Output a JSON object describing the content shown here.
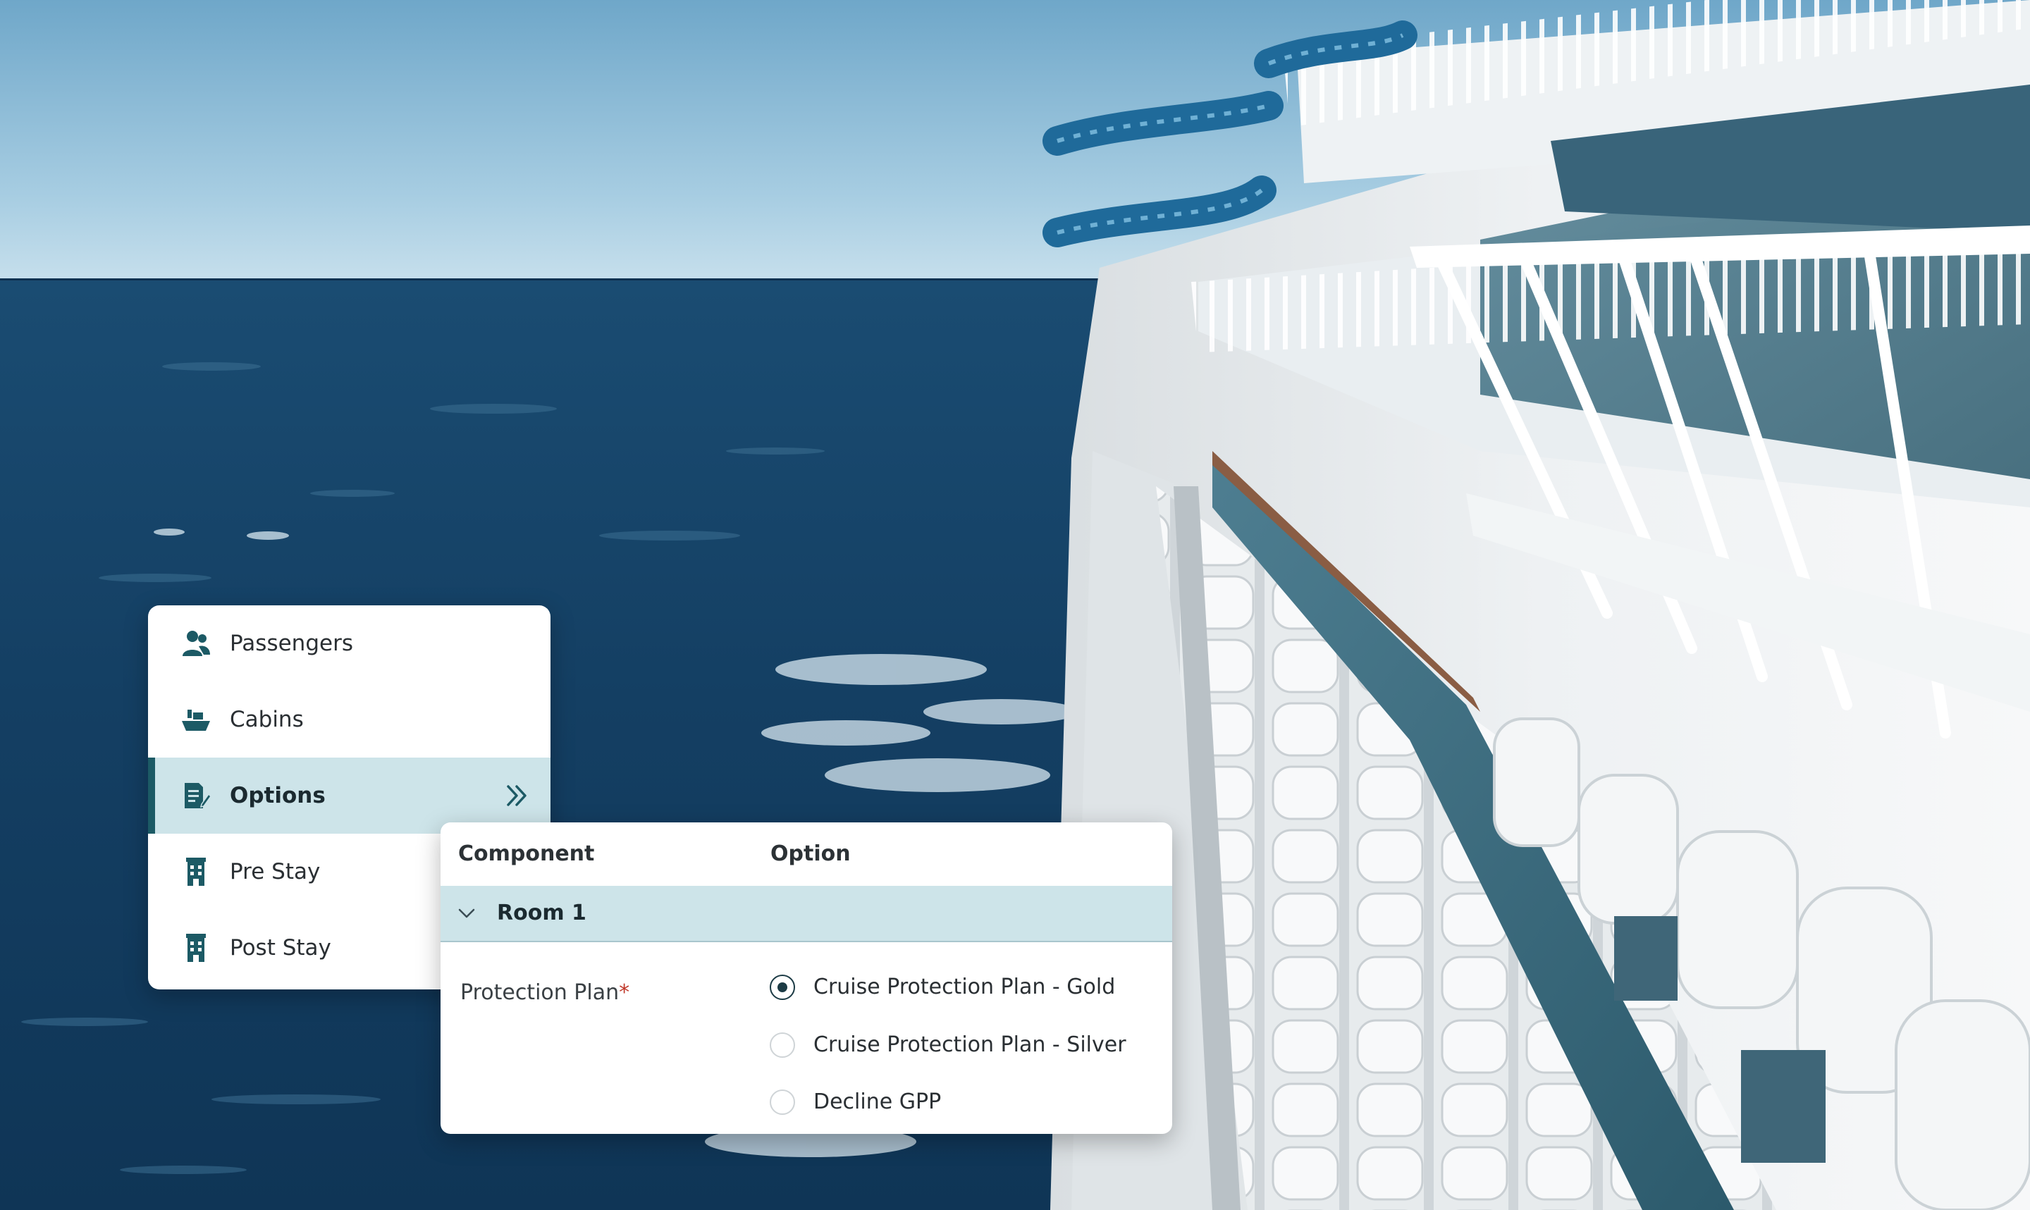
{
  "nav": {
    "items": [
      {
        "label": "Passengers",
        "icon": "passengers-icon",
        "active": false
      },
      {
        "label": "Cabins",
        "icon": "ship-icon",
        "active": false
      },
      {
        "label": "Options",
        "icon": "options-list-icon",
        "active": true
      },
      {
        "label": "Pre Stay",
        "icon": "hotel-icon",
        "active": false
      },
      {
        "label": "Post Stay",
        "icon": "hotel-icon",
        "active": false
      }
    ],
    "active_icon": "double-chevron-right-icon"
  },
  "panel": {
    "columns": {
      "component": "Component",
      "option": "Option"
    },
    "group": {
      "label": "Room 1",
      "expanded": true,
      "icon": "chevron-down-icon"
    },
    "field": {
      "label": "Protection Plan",
      "required_mark": "*",
      "options": [
        {
          "label": "Cruise Protection Plan - Gold",
          "selected": true
        },
        {
          "label": "Cruise Protection Plan - Silver",
          "selected": false
        },
        {
          "label": "Decline GPP",
          "selected": false
        }
      ]
    }
  },
  "colors": {
    "accent": "#1c5a65",
    "highlight": "#cde4e9",
    "required": "#c0392b"
  }
}
